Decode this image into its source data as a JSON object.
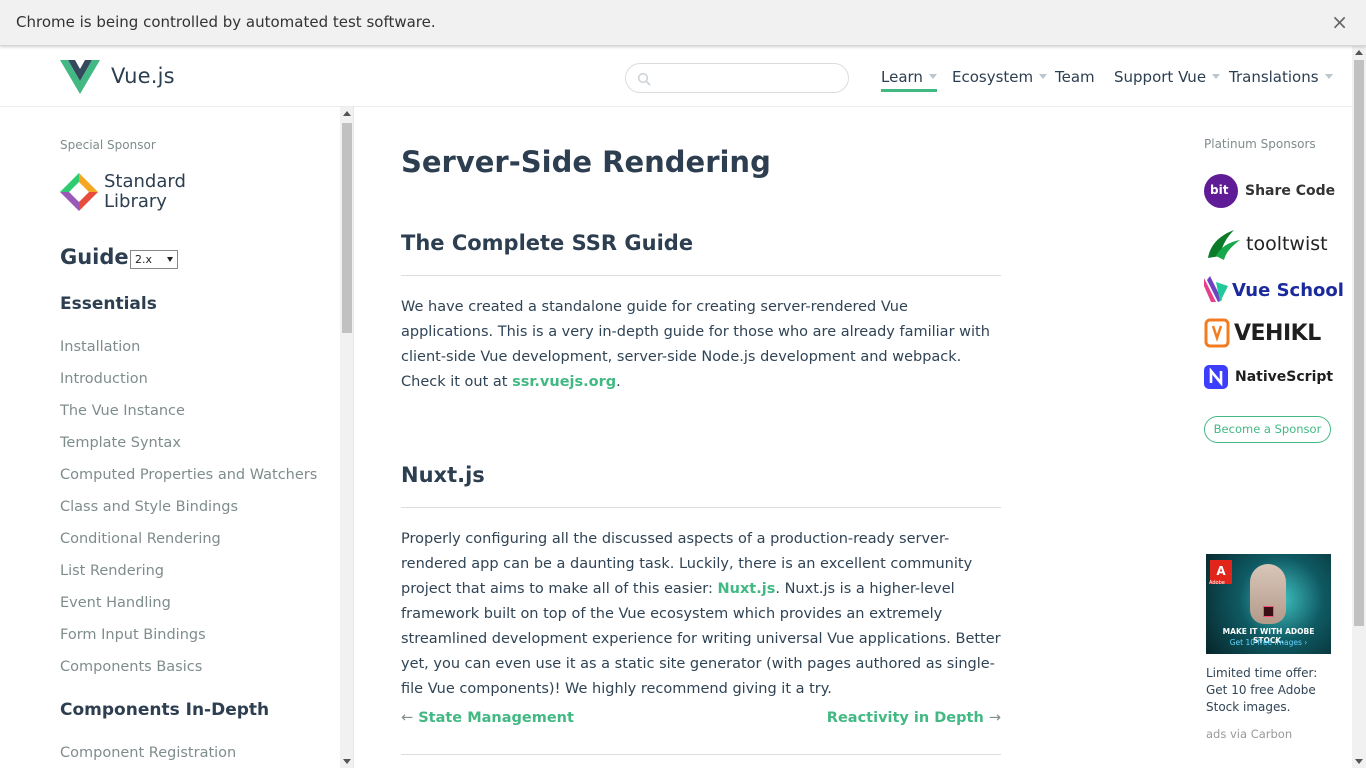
{
  "infobar": {
    "message": "Chrome is being controlled by automated test software.",
    "close_glyph": "×"
  },
  "header": {
    "logo_text": "Vue.js",
    "search_placeholder": "",
    "nav": [
      {
        "label": "Learn",
        "dropdown": true,
        "active": true
      },
      {
        "label": "Ecosystem",
        "dropdown": true,
        "active": false
      },
      {
        "label": "Team",
        "dropdown": false,
        "active": false
      },
      {
        "label": "Support Vue",
        "dropdown": true,
        "active": false
      },
      {
        "label": "Translations",
        "dropdown": true,
        "active": false
      }
    ]
  },
  "sidebar": {
    "special_sponsor_label": "Special Sponsor",
    "special_sponsor_name_line1": "Standard",
    "special_sponsor_name_line2": "Library",
    "guide_title": "Guide",
    "version": "2.x",
    "section1_title": "Essentials",
    "section1_items": [
      "Installation",
      "Introduction",
      "The Vue Instance",
      "Template Syntax",
      "Computed Properties and Watchers",
      "Class and Style Bindings",
      "Conditional Rendering",
      "List Rendering",
      "Event Handling",
      "Form Input Bindings",
      "Components Basics"
    ],
    "section2_title": "Components In-Depth",
    "section2_items": [
      "Component Registration"
    ]
  },
  "main": {
    "title": "Server-Side Rendering",
    "section1": {
      "heading": "The Complete SSR Guide",
      "text": "We have created a standalone guide for creating server-rendered Vue applications. This is a very in-depth guide for those who are already familiar with client-side Vue development, server-side Node.js development and webpack. Check it out at ",
      "link": "ssr.vuejs.org",
      "after": "."
    },
    "section2": {
      "heading": "Nuxt.js",
      "text_before": "Properly configuring all the discussed aspects of a production-ready server-rendered app can be a daunting task. Luckily, there is an excellent community project that aims to make all of this easier: ",
      "link": "Nuxt.js",
      "text_after": ". Nuxt.js is a higher-level framework built on top of the Vue ecosystem which provides an extremely streamlined development experience for writing universal Vue applications. Better yet, you can even use it as a static site generator (with pages authored as single-file Vue components)! We highly recommend giving it a try."
    },
    "prev": {
      "arrow": "←",
      "label": "State Management"
    },
    "next": {
      "arrow": "→",
      "label": "Reactivity in Depth"
    }
  },
  "sponsors": {
    "label": "Platinum Sponsors",
    "items": [
      {
        "badge": "bit",
        "name": "Share Code",
        "color": "#5f1c96"
      },
      {
        "name": "tooltwist",
        "color": "#0b7b2a"
      },
      {
        "name": "Vue School",
        "color": "#1a2a9c"
      },
      {
        "name": "VEHIKL",
        "color": "#1f1f1f"
      },
      {
        "name": "NativeScript",
        "color": "#3d3dfd"
      }
    ],
    "become_label": "Become a Sponsor",
    "ad": {
      "brand": "Adobe",
      "line1": "MAKE IT WITH ADOBE STOCK.",
      "line2": "Get 10 free images ›",
      "text": "Limited time offer: Get 10 free Adobe Stock images.",
      "via": "ads via Carbon"
    }
  },
  "colors": {
    "accent": "#42b983",
    "text": "#2c3e50"
  }
}
